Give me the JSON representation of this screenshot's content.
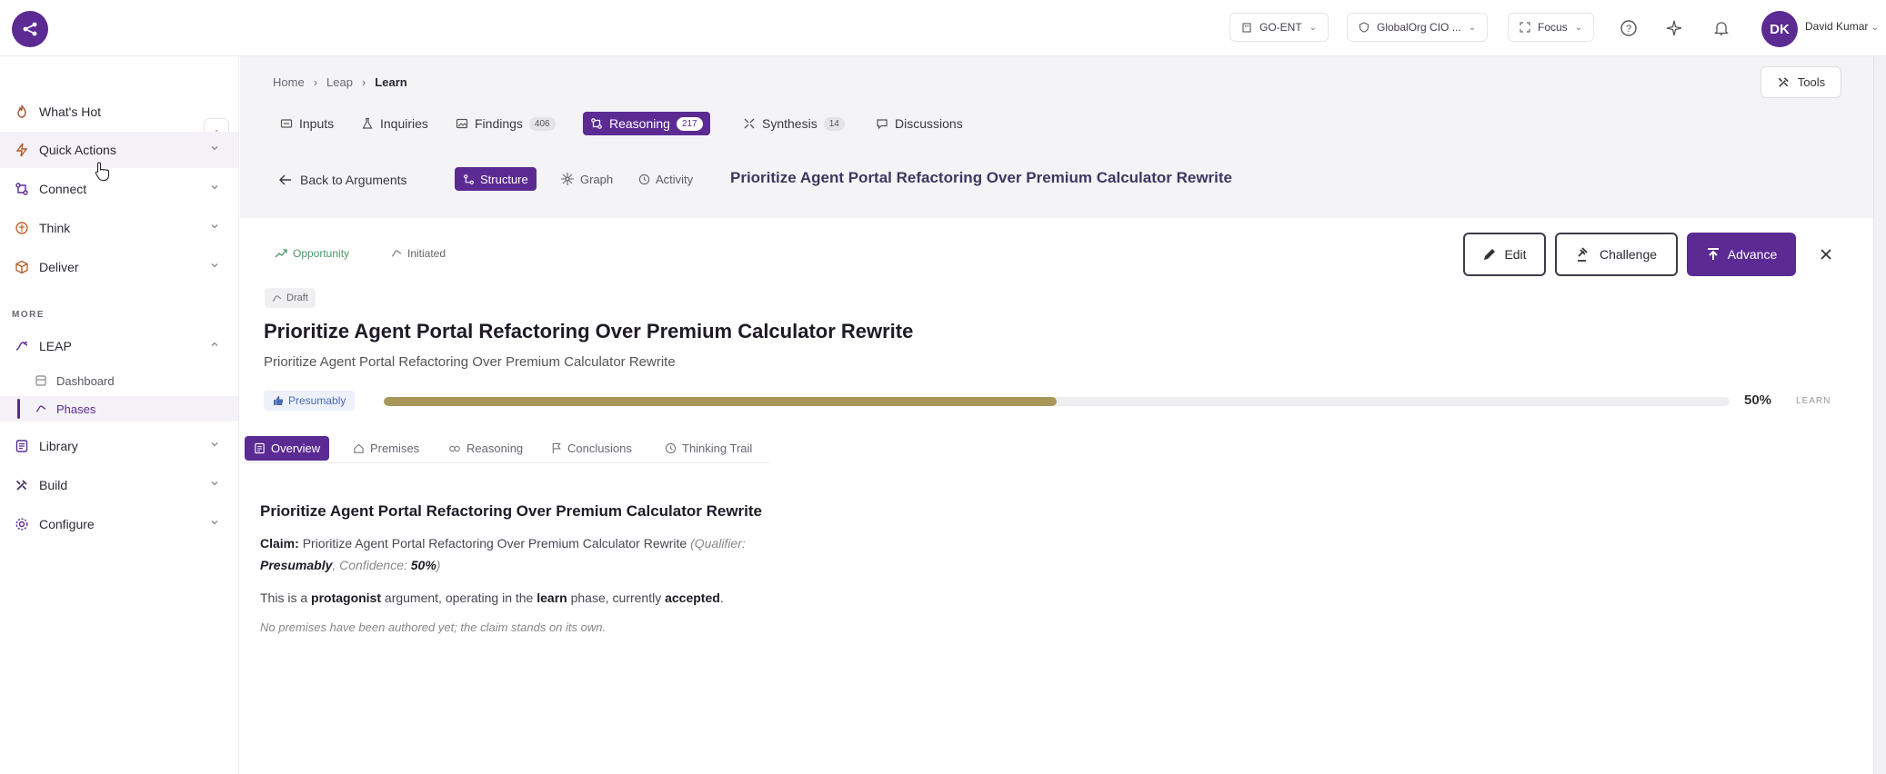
{
  "topbar": {
    "org_chip": "GO-ENT",
    "role_chip": "GlobalOrg CIO ...",
    "focus_chip": "Focus",
    "avatar_initials": "DK",
    "user_name": "David Kumar"
  },
  "sidebar": {
    "items": [
      {
        "label": "What's Hot"
      },
      {
        "label": "Quick Actions"
      },
      {
        "label": "Connect"
      },
      {
        "label": "Think"
      },
      {
        "label": "Deliver"
      }
    ],
    "more_label": "MORE",
    "leap": {
      "label": "LEAP",
      "sub": [
        {
          "label": "Dashboard"
        },
        {
          "label": "Phases"
        }
      ]
    },
    "lower_items": [
      {
        "label": "Library"
      },
      {
        "label": "Build"
      },
      {
        "label": "Configure"
      }
    ]
  },
  "breadcrumb": {
    "home": "Home",
    "leap": "Leap",
    "current": "Learn"
  },
  "tools_label": "Tools",
  "phase_tabs": [
    {
      "label": "Inputs"
    },
    {
      "label": "Inquiries"
    },
    {
      "label": "Findings",
      "count": "406"
    },
    {
      "label": "Reasoning",
      "count": "217"
    },
    {
      "label": "Synthesis",
      "count": "14"
    },
    {
      "label": "Discussions"
    }
  ],
  "back_label": "Back to Arguments",
  "view_tabs": [
    {
      "label": "Structure"
    },
    {
      "label": "Graph"
    },
    {
      "label": "Activity"
    }
  ],
  "header_title": "Prioritize Agent Portal Refactoring Over Premium Calculator Rewrite",
  "card": {
    "type_tag": "Opportunity",
    "status_tag": "Initiated",
    "draft_tag": "Draft",
    "edit_label": "Edit",
    "challenge_label": "Challenge",
    "advance_label": "Advance",
    "title": "Prioritize Agent Portal Refactoring Over Premium Calculator Rewrite",
    "subtitle": "Prioritize Agent Portal Refactoring Over Premium Calculator Rewrite",
    "qualifier": "Presumably",
    "confidence_fraction": 0.5,
    "confidence_label": "50%",
    "phase_label": "LEARN"
  },
  "content_tabs": [
    {
      "label": "Overview"
    },
    {
      "label": "Premises"
    },
    {
      "label": "Reasoning"
    },
    {
      "label": "Conclusions"
    },
    {
      "label": "Thinking Trail"
    }
  ],
  "overview": {
    "title": "Prioritize Agent Portal Refactoring Over Premium Calculator Rewrite",
    "claim_label": "Claim:",
    "claim_text": "Prioritize Agent Portal Refactoring Over Premium Calculator Rewrite",
    "qualifier_open": "(Qualifier:",
    "qualifier_value": "Presumably",
    "confidence_text": ", Confidence:",
    "confidence_value": "50%",
    "close_paren": ")",
    "line3_a": "This is a ",
    "line3_b": "protagonist",
    "line3_c": " argument, operating in the ",
    "line3_d": "learn",
    "line3_e": " phase, currently ",
    "line3_f": "accepted",
    "line3_g": ".",
    "note": "No premises have been authored yet; the claim stands on its own."
  },
  "colors": {
    "accent": "#5b2a93",
    "progress": "#a89758",
    "type_tag": "#4a9a6a"
  }
}
